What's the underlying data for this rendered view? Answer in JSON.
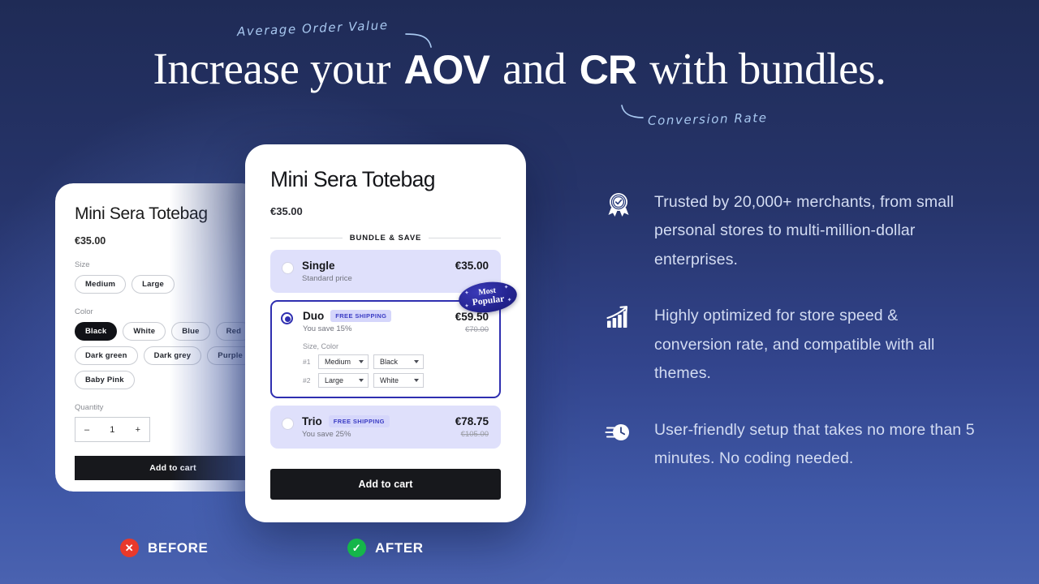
{
  "headline": {
    "part1": "Increase your ",
    "mark1": "AOV",
    "part2": " and ",
    "mark2": "CR",
    "part3": " with bundles.",
    "annotation_aov": "Average Order Value",
    "annotation_cr": "Conversion Rate",
    "highlight_color": "#2f6fd0"
  },
  "before_card": {
    "title": "Mini Sera Totebag",
    "price": "€35.00",
    "size_label": "Size",
    "sizes": [
      "Medium",
      "Large"
    ],
    "color_label": "Color",
    "colors_row1": [
      "Black",
      "White",
      "Blue",
      "Red"
    ],
    "colors_row2": [
      "Dark green",
      "Dark grey",
      "Purple"
    ],
    "colors_row3": [
      "Baby Pink"
    ],
    "selected_color": "Black",
    "quantity_label": "Quantity",
    "quantity_minus": "–",
    "quantity_value": "1",
    "quantity_plus": "+",
    "add_to_cart": "Add to cart"
  },
  "after_card": {
    "title": "Mini Sera Totebag",
    "price": "€35.00",
    "divider_label": "BUNDLE & SAVE",
    "badge_most_popular_line1": "Most",
    "badge_most_popular_line2": "Popular",
    "options": [
      {
        "name": "Single",
        "sub": "Standard price",
        "price": "€35.00",
        "compare": "",
        "badge": "",
        "selected": false
      },
      {
        "name": "Duo",
        "sub": "You save 15%",
        "price": "€59.50",
        "compare": "€70.00",
        "badge": "FREE SHIPPING",
        "selected": true,
        "variant_label": "Size, Color",
        "variants": [
          {
            "index": "#1",
            "size": "Medium",
            "color": "Black"
          },
          {
            "index": "#2",
            "size": "Large",
            "color": "White"
          }
        ]
      },
      {
        "name": "Trio",
        "sub": "You save 25%",
        "price": "€78.75",
        "compare": "€105.00",
        "badge": "FREE SHIPPING",
        "selected": false
      }
    ],
    "add_to_cart": "Add to cart"
  },
  "features": [
    {
      "icon": "award-badge-icon",
      "text": "Trusted by 20,000+ merchants, from small personal stores to multi-million-dollar enterprises."
    },
    {
      "icon": "bar-chart-growth-icon",
      "text": "Highly optimized for store speed & conversion rate, and compatible with all themes."
    },
    {
      "icon": "fast-clock-icon",
      "text": "User-friendly setup that takes no more than 5 minutes. No coding needed."
    }
  ],
  "comparison_labels": {
    "before": "BEFORE",
    "before_icon": "✕",
    "after": "AFTER",
    "after_icon": "✓",
    "before_color": "#e8392b",
    "after_color": "#15b64a"
  }
}
